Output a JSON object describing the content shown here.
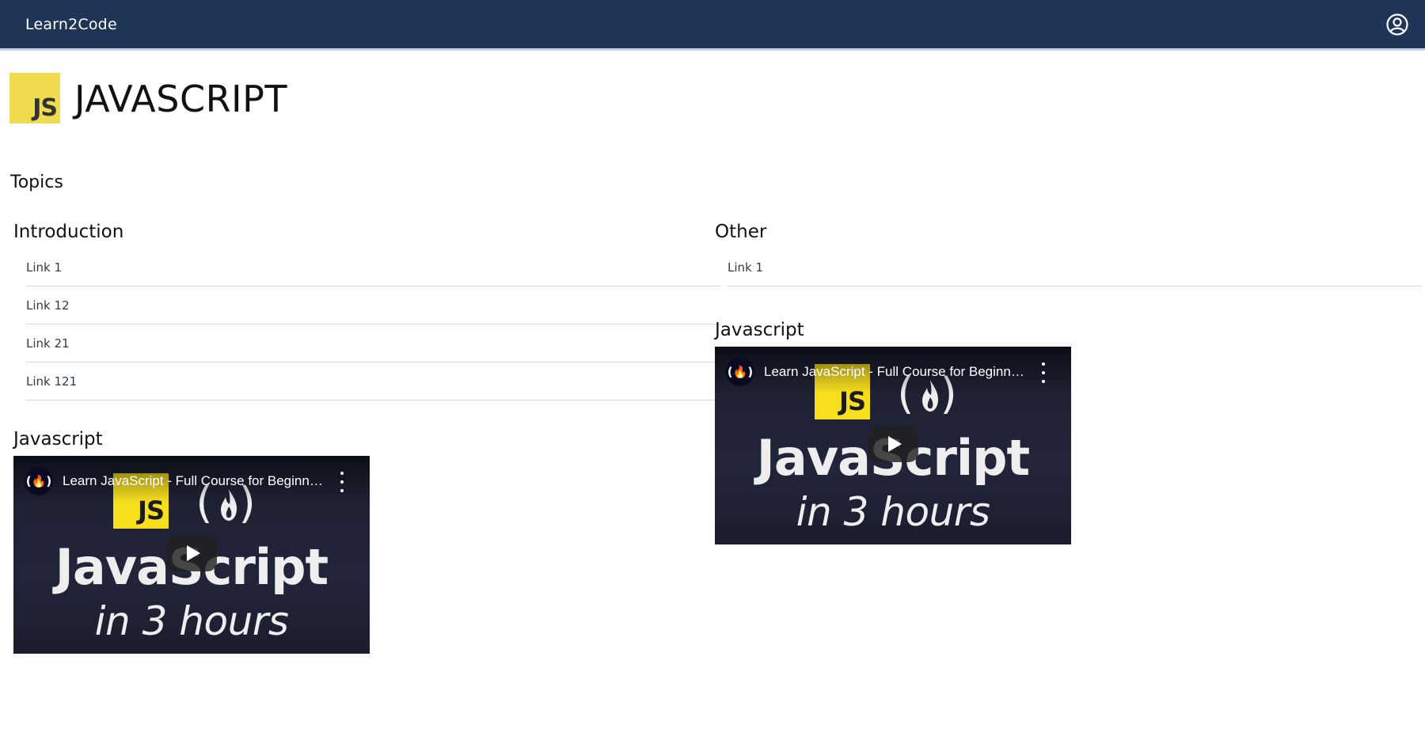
{
  "navbar": {
    "brand": "Learn2Code",
    "account_icon": "account-circle-icon",
    "background": "#1e3557"
  },
  "page": {
    "logo_text": "JS",
    "logo_color": "#f0db4f",
    "title": "JAVASCRIPT",
    "topics_heading": "Topics"
  },
  "sections": {
    "introduction": {
      "title": "Introduction",
      "links": [
        "Link 1",
        "Link 12",
        "Link 21",
        "Link 121"
      ],
      "video": {
        "title": "Javascript",
        "channel_icon": "freecodecamp-icon",
        "caption": "Learn JavaScript - Full Course for Beginners",
        "thumb_badge": "JS",
        "thumb_line1": "JavaScript",
        "thumb_line2": "in 3 hours"
      }
    },
    "other": {
      "title": "Other",
      "links": [
        "Link 1"
      ],
      "video": {
        "title": "Javascript",
        "channel_icon": "freecodecamp-icon",
        "caption": "Learn JavaScript - Full Course for Beginners",
        "thumb_badge": "JS",
        "thumb_line1": "JavaScript",
        "thumb_line2": "in 3 hours"
      }
    }
  }
}
